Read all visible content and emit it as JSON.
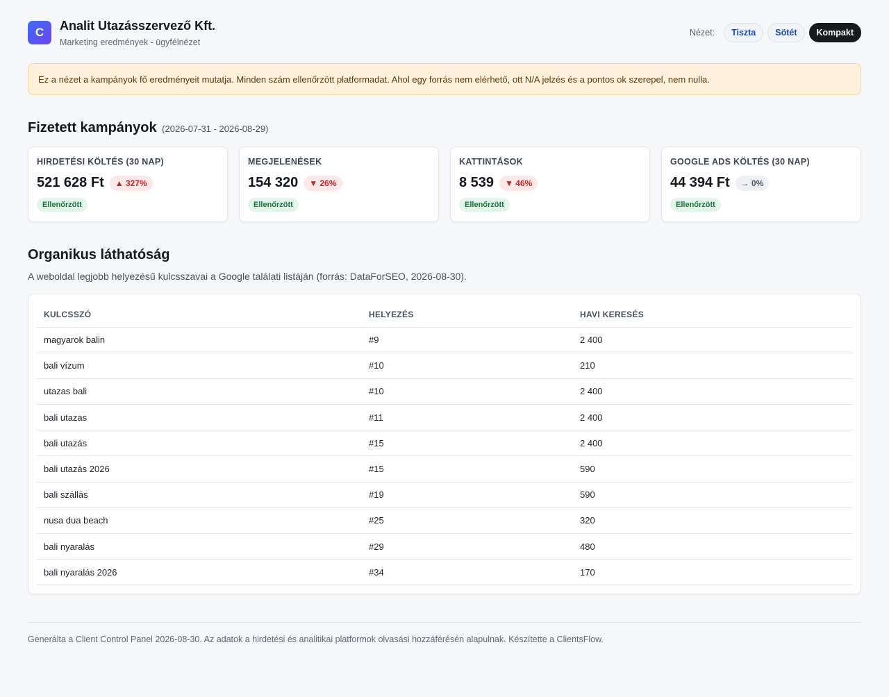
{
  "header": {
    "logo_letter": "C",
    "title": "Analit Utazásszervező Kft.",
    "subtitle": "Marketing eredmények - ügyfélnézet",
    "view_label": "Nézet:",
    "views": [
      {
        "label": "Tiszta",
        "active": false
      },
      {
        "label": "Sötét",
        "active": false
      },
      {
        "label": "Kompakt",
        "active": true
      }
    ]
  },
  "notice": "Ez a nézet a kampányok fő eredményeit mutatja. Minden szám ellenőrzött platformadat. Ahol egy forrás nem elérhető, ott N/A jelzés és a pontos ok szerepel, nem nulla.",
  "paid": {
    "title": "Fizetett kampányok",
    "range": "(2026-07-31 - 2026-08-29)",
    "cards": [
      {
        "label": "HIRDETÉSI KÖLTÉS (30 NAP)",
        "value": "521 628 Ft",
        "delta": "▲ 327%",
        "trend": "up",
        "badge": "Ellenőrzött"
      },
      {
        "label": "MEGJELENÉSEK",
        "value": "154 320",
        "delta": "▼ 26%",
        "trend": "down",
        "badge": "Ellenőrzött"
      },
      {
        "label": "KATTINTÁSOK",
        "value": "8 539",
        "delta": "▼ 46%",
        "trend": "down",
        "badge": "Ellenőrzött"
      },
      {
        "label": "GOOGLE ADS KÖLTÉS (30 NAP)",
        "value": "44 394 Ft",
        "delta": "→ 0%",
        "trend": "flat",
        "badge": "Ellenőrzött"
      }
    ]
  },
  "organic": {
    "title": "Organikus láthatóság",
    "description": "A weboldal legjobb helyezésű kulcsszavai a Google találati listáján (forrás: DataForSEO, 2026-08-30).",
    "columns": [
      "KULCSSZÓ",
      "HELYEZÉS",
      "HAVI KERESÉS"
    ],
    "rows": [
      [
        "magyarok balin",
        "#9",
        "2 400"
      ],
      [
        "bali vízum",
        "#10",
        "210"
      ],
      [
        "utazas bali",
        "#10",
        "2 400"
      ],
      [
        "bali utazas",
        "#11",
        "2 400"
      ],
      [
        "bali utazás",
        "#15",
        "2 400"
      ],
      [
        "bali utazás 2026",
        "#15",
        "590"
      ],
      [
        "bali szállás",
        "#19",
        "590"
      ],
      [
        "nusa dua beach",
        "#25",
        "320"
      ],
      [
        "bali nyaralás",
        "#29",
        "480"
      ],
      [
        "bali nyaralás 2026",
        "#34",
        "170"
      ]
    ]
  },
  "footer": "Generálta a Client Control Panel 2026-08-30. Az adatok a hirdetési és analitikai platformok olvasási hozzáférésén alapulnak. Készítette a ClientsFlow."
}
